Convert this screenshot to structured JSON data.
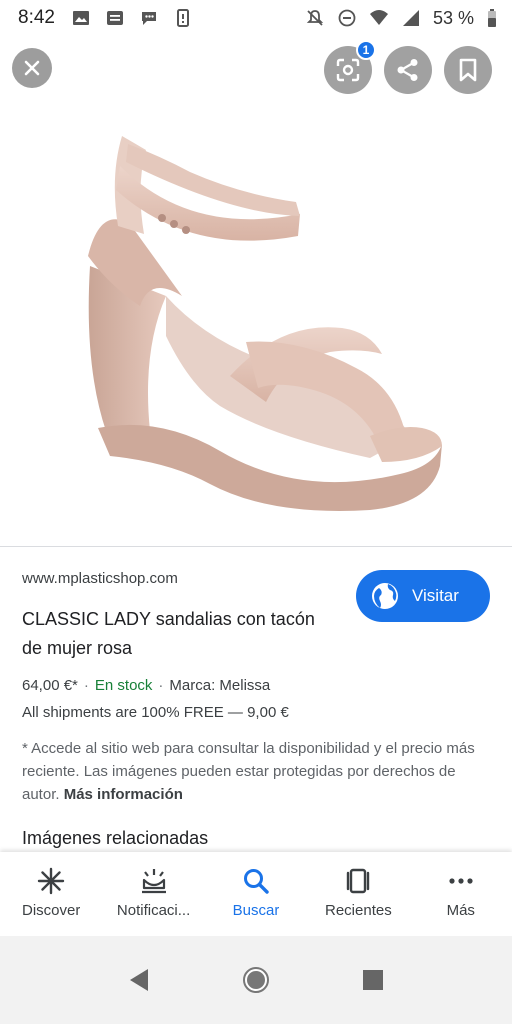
{
  "status_bar": {
    "time": "8:42",
    "battery": "53 %",
    "icons": [
      "image-icon",
      "news-icon",
      "assistant-icon",
      "vibrate-icon",
      "mute-icon",
      "dnd-icon",
      "wifi-icon",
      "signal-icon",
      "battery-icon"
    ]
  },
  "viewer": {
    "controls": [
      "close-icon",
      "lens-icon",
      "share-icon",
      "bookmark-icon"
    ],
    "lens_badge": "1",
    "image_subject": "pink plastic high-heel sandal"
  },
  "details": {
    "source_domain": "www.mplasticshop.com",
    "visit_label": "Visitar",
    "title": "CLASSIC LADY sandalias con tacón de mujer rosa",
    "price": "64,00 €*",
    "stock": "En stock",
    "brand": "Marca: Melissa",
    "separator": "·",
    "shipping": "All shipments are 100% FREE — 9,00 €",
    "disclaimer": "* Accede al sitio web para consultar la disponibilidad y el precio más reciente. Las imágenes pueden estar protegidas por derechos de autor.",
    "more_info": "Más información",
    "related_heading": "Imágenes relacionadas"
  },
  "bottom_nav": [
    {
      "label": "Discover",
      "icon": "asterisk-icon"
    },
    {
      "label": "Notificaci...",
      "icon": "notifications-icon"
    },
    {
      "label": "Buscar",
      "icon": "search-icon"
    },
    {
      "label": "Recientes",
      "icon": "recents-icon"
    },
    {
      "label": "Más",
      "icon": "more-icon"
    }
  ],
  "colors": {
    "accent": "#1a73e8",
    "stock_green": "#188038",
    "sandal": "#dcb9ab"
  }
}
